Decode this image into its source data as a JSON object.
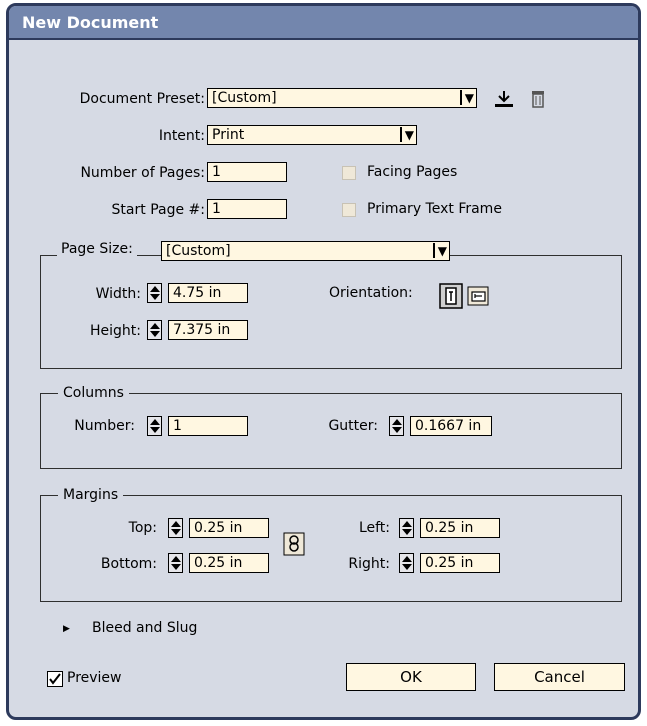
{
  "window": {
    "title": "New Document"
  },
  "preset": {
    "label": "Document Preset:",
    "value": "[Custom]",
    "save_icon": "save-preset-icon",
    "delete_icon": "trash-icon"
  },
  "intent": {
    "label": "Intent:",
    "value": "Print"
  },
  "pages": {
    "label": "Number of Pages:",
    "value": "1"
  },
  "start_page": {
    "label": "Start Page #:",
    "value": "1"
  },
  "facing_pages": {
    "label": "Facing Pages",
    "checked": false
  },
  "primary_text_frame": {
    "label": "Primary Text Frame",
    "checked": false
  },
  "page_size": {
    "label": "Page Size:",
    "value": "[Custom]",
    "width_label": "Width:",
    "width": "4.75 in",
    "height_label": "Height:",
    "height": "7.375 in",
    "orientation_label": "Orientation:",
    "orientation": "portrait"
  },
  "columns": {
    "title": "Columns",
    "number_label": "Number:",
    "number": "1",
    "gutter_label": "Gutter:",
    "gutter": "0.1667 in"
  },
  "margins": {
    "title": "Margins",
    "top_label": "Top:",
    "top": "0.25 in",
    "bottom_label": "Bottom:",
    "bottom": "0.25 in",
    "left_label": "Left:",
    "left": "0.25 in",
    "right_label": "Right:",
    "right": "0.25 in",
    "link_icon": "chain-link-icon"
  },
  "bleed": {
    "label": "Bleed and Slug"
  },
  "preview": {
    "label": "Preview",
    "checked": true
  },
  "buttons": {
    "ok": "OK",
    "cancel": "Cancel"
  },
  "colors": {
    "titlebar": "#7386ad",
    "dialog_bg": "#d6dae4",
    "field_bg": "#fff7e1",
    "border": "#2d3a5c"
  }
}
